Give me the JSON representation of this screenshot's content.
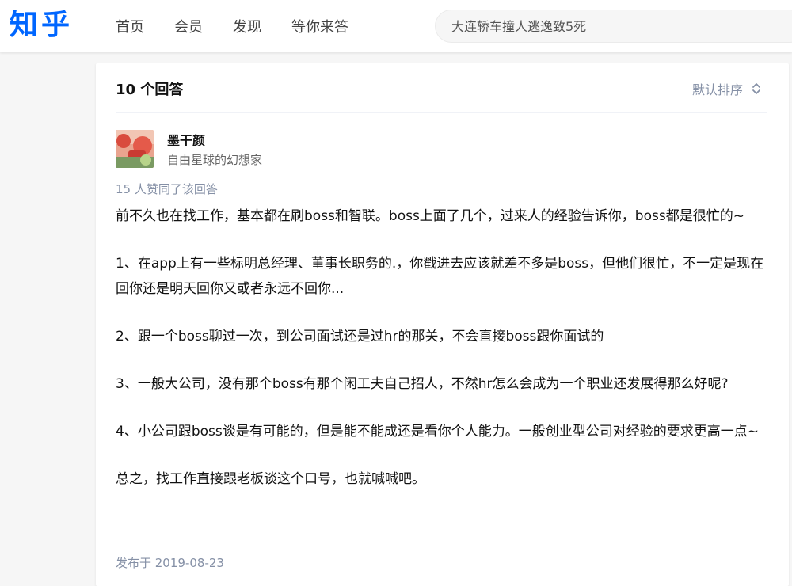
{
  "header": {
    "logo": "知乎",
    "nav": [
      "首页",
      "会员",
      "发现",
      "等你来答"
    ],
    "search_placeholder": "大连轿车撞人逃逸致5死"
  },
  "answers": {
    "count_label": "10 个回答",
    "sort_label": "默认排序",
    "sort_icon": "chevron-up-down-icon"
  },
  "answer": {
    "author_name": "墨干颜",
    "author_bio": "自由星球的幻想家",
    "vote_text": "15 人赞同了该回答",
    "paragraphs": [
      "前不久也在找工作，基本都在刷boss和智联。boss上面了几个，过来人的经验告诉你，boss都是很忙的~",
      "1、在app上有一些标明总经理、董事长职务的.，你戳进去应该就差不多是boss，但他们很忙，不一定是现在回你还是明天回你又或者永远不回你...",
      "2、跟一个boss聊过一次，到公司面试还是过hr的那关，不会直接boss跟你面试的",
      "3、一般大公司，没有那个boss有那个闲工夫自己招人，不然hr怎么会成为一个职业还发展得那么好呢?",
      "4、小公司跟boss谈是有可能的，但是能不能成还是看你个人能力。一般创业型公司对经验的要求更高一点~",
      "总之，找工作直接跟老板谈这个口号，也就喊喊吧。"
    ],
    "published": "发布于 2019-08-23"
  },
  "colors": {
    "brand": "#0066ff",
    "meta": "#8590a6",
    "text": "#121212"
  }
}
